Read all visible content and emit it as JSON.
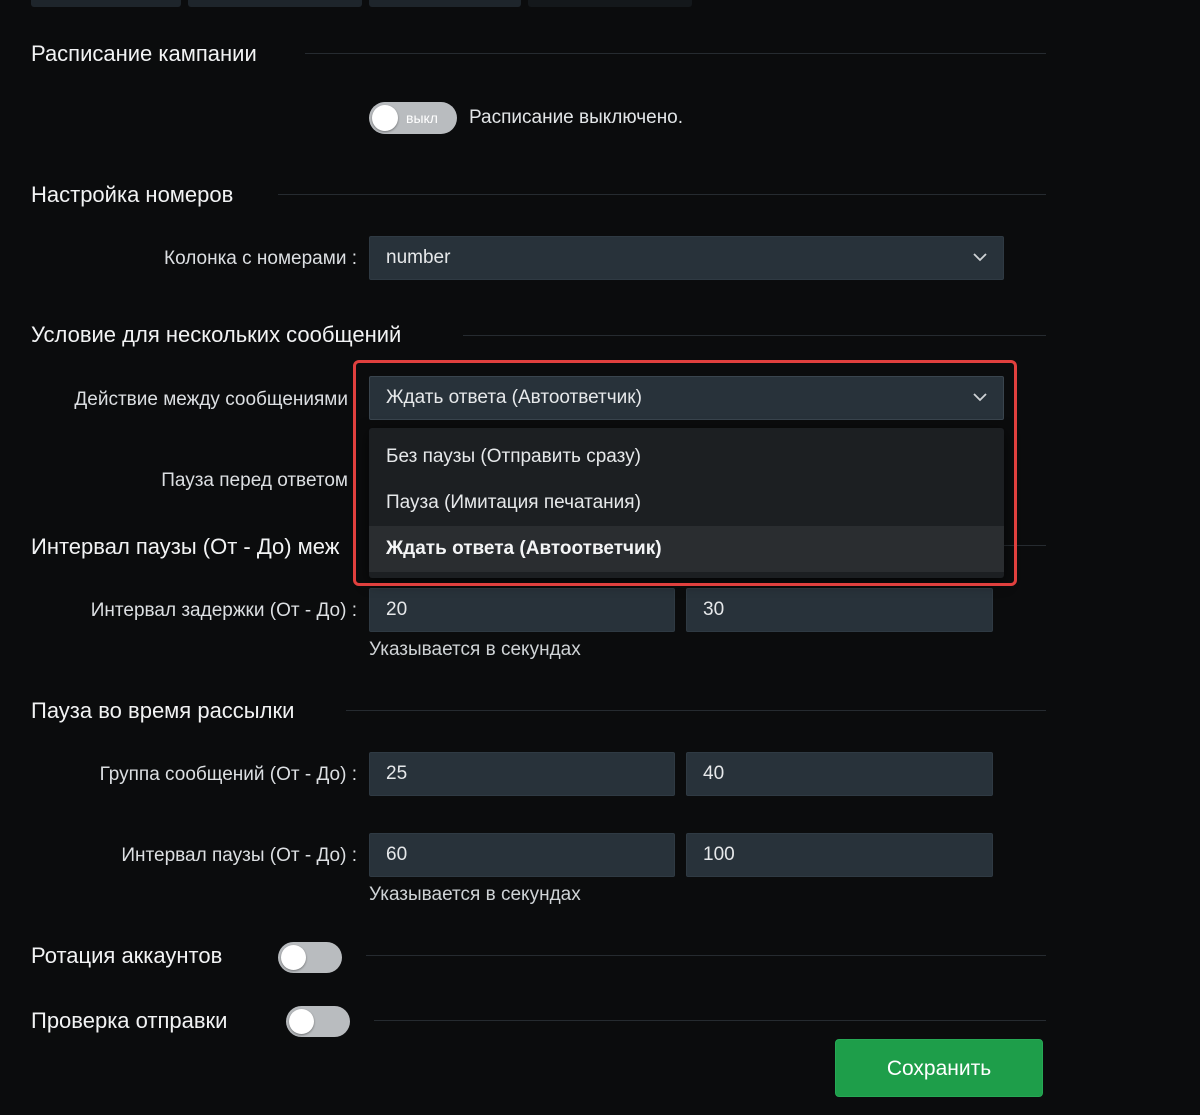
{
  "schedule": {
    "title": "Расписание кампании",
    "toggle_text": "выкл",
    "status": "Расписание выключено."
  },
  "numbers": {
    "title": "Настройка номеров",
    "column_label": "Колонка с номерами :",
    "column_value": "number"
  },
  "multi": {
    "title": "Условие для нескольких сообщений",
    "action_label": "Действие между сообщениями",
    "action_value": "Ждать ответа (Автоответчик)",
    "pause_label": "Пауза перед ответом",
    "options": [
      "Без паузы (Отправить сразу)",
      "Пауза (Имитация печатания)",
      "Ждать ответа (Автоответчик)"
    ],
    "selected_option": "Ждать ответа (Автоответчик)"
  },
  "interval": {
    "title": "Интервал паузы (От - До) меж",
    "delay_label": "Интервал задержки (От - До) :",
    "from": "20",
    "to": "30",
    "hint": "Указывается в секундах"
  },
  "mailing_pause": {
    "title": "Пауза во время рассылки",
    "group_label": "Группа сообщений (От - До) :",
    "group_from": "25",
    "group_to": "40",
    "pause_label": "Интервал паузы (От - До) :",
    "pause_from": "60",
    "pause_to": "100",
    "hint": "Указывается в секундах"
  },
  "rotation": {
    "title": "Ротация аккаунтов"
  },
  "check": {
    "title": "Проверка отправки"
  },
  "save_label": "Сохранить",
  "colors": {
    "background": "#0b0c0d",
    "input_bg": "#28323a",
    "highlight": "#e0403e",
    "save": "#1e9e4a"
  },
  "icons": {
    "select_chevron": "chevron-down-icon"
  }
}
